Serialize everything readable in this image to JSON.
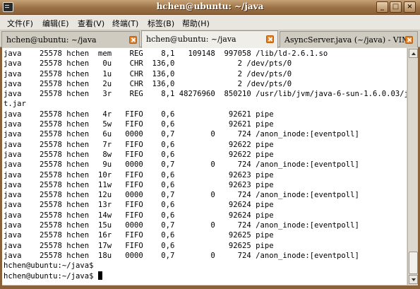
{
  "window": {
    "title": "hchen@ubuntu: ~/java",
    "buttons": {
      "minimize": "_",
      "maximize": "□",
      "close": "×"
    }
  },
  "menu": {
    "items": [
      "文件(F)",
      "编辑(E)",
      "查看(V)",
      "终端(T)",
      "标签(B)",
      "帮助(H)"
    ]
  },
  "tabs": [
    {
      "label": "hchen@ubuntu: ~/java",
      "active": false
    },
    {
      "label": "hchen@ubuntu: ~/java",
      "active": true
    },
    {
      "label": "AsyncServer.java (~/java) - VIM",
      "active": false
    }
  ],
  "terminal": {
    "lines": [
      "java    25578 hchen  mem    REG    8,1   109148  997058 /lib/ld-2.6.1.so",
      "java    25578 hchen   0u    CHR  136,0              2 /dev/pts/0",
      "java    25578 hchen   1u    CHR  136,0              2 /dev/pts/0",
      "java    25578 hchen   2u    CHR  136,0              2 /dev/pts/0",
      "java    25578 hchen   3r    REG    8,1 48276960  850210 /usr/lib/jvm/java-6-sun-1.6.0.03/j",
      "t.jar",
      "java    25578 hchen   4r   FIFO    0,6            92621 pipe",
      "java    25578 hchen   5w   FIFO    0,6            92621 pipe",
      "java    25578 hchen   6u   0000    0,7        0     724 /anon_inode:[eventpoll]",
      "java    25578 hchen   7r   FIFO    0,6            92622 pipe",
      "java    25578 hchen   8w   FIFO    0,6            92622 pipe",
      "java    25578 hchen   9u   0000    0,7        0     724 /anon_inode:[eventpoll]",
      "java    25578 hchen  10r   FIFO    0,6            92623 pipe",
      "java    25578 hchen  11w   FIFO    0,6            92623 pipe",
      "java    25578 hchen  12u   0000    0,7        0     724 /anon_inode:[eventpoll]",
      "java    25578 hchen  13r   FIFO    0,6            92624 pipe",
      "java    25578 hchen  14w   FIFO    0,6            92624 pipe",
      "java    25578 hchen  15u   0000    0,7        0     724 /anon_inode:[eventpoll]",
      "java    25578 hchen  16r   FIFO    0,6            92625 pipe",
      "java    25578 hchen  17w   FIFO    0,6            92625 pipe",
      "java    25578 hchen  18u   0000    0,7        0     724 /anon_inode:[eventpoll]",
      "hchen@ubuntu:~/java$",
      "hchen@ubuntu:~/java$ "
    ]
  }
}
